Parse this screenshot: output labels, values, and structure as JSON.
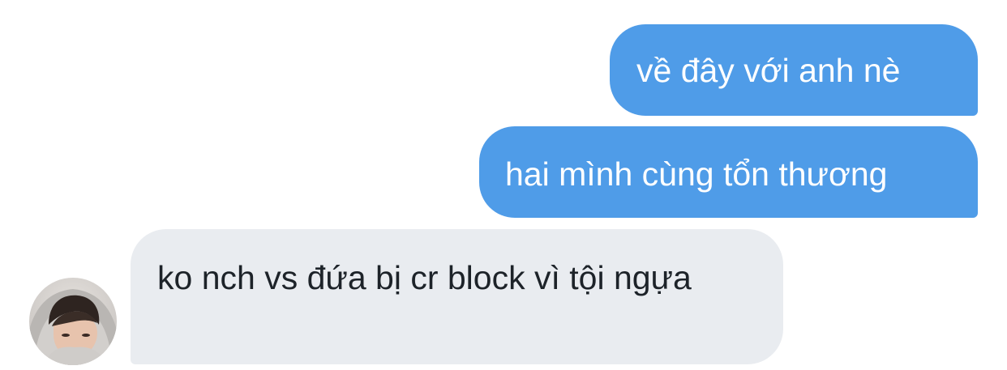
{
  "messages": [
    {
      "direction": "sent",
      "text": "về đây với anh nè"
    },
    {
      "direction": "sent",
      "text": "hai mình cùng tổn thương"
    },
    {
      "direction": "received",
      "text": "ko nch vs đứa bị cr block vì tội ngựa"
    }
  ],
  "avatar": {
    "icon": "profile-photo",
    "accent": "#3a2d27"
  },
  "colors": {
    "sent_bubble": "#4f9ce8",
    "received_bubble": "#e9ecf0",
    "received_text": "#1d2329",
    "background": "#ffffff"
  }
}
